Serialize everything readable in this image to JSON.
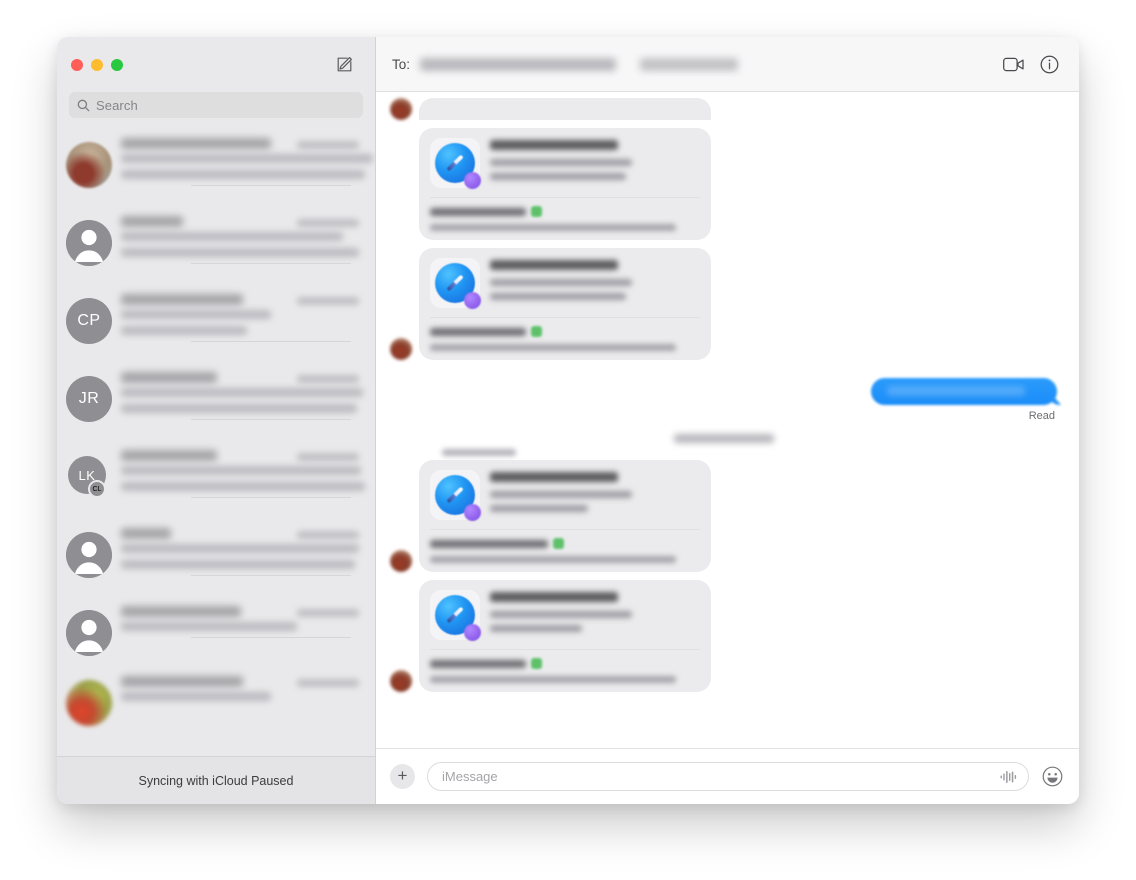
{
  "window": {
    "traffic_lights": [
      {
        "name": "close",
        "color": "#ff5f57"
      },
      {
        "name": "minimize",
        "color": "#febc2e"
      },
      {
        "name": "maximize",
        "color": "#28c840"
      }
    ]
  },
  "sidebar": {
    "compose_icon": "compose-icon",
    "search": {
      "placeholder": "Search",
      "icon": "search-icon"
    },
    "conversations": [
      {
        "avatar_type": "photo",
        "avatar_value": "",
        "unread": true,
        "name": "",
        "time": "",
        "snippet_lines": 2
      },
      {
        "avatar_type": "person",
        "avatar_value": "",
        "unread": true,
        "name": "",
        "time": "",
        "snippet_lines": 2
      },
      {
        "avatar_type": "initials",
        "avatar_value": "CP",
        "unread": true,
        "name": "",
        "time": "",
        "snippet_lines": 2
      },
      {
        "avatar_type": "initials",
        "avatar_value": "JR",
        "unread": false,
        "name": "",
        "time": "",
        "snippet_lines": 2
      },
      {
        "avatar_type": "initials-group",
        "avatar_value": "LK",
        "badge_value": "CL",
        "unread": false,
        "name": "",
        "time": "",
        "snippet_lines": 2
      },
      {
        "avatar_type": "person",
        "avatar_value": "",
        "unread": true,
        "name": "",
        "time": "",
        "snippet_lines": 2
      },
      {
        "avatar_type": "person",
        "avatar_value": "",
        "unread": true,
        "name": "",
        "time": "",
        "snippet_lines": 1
      },
      {
        "avatar_type": "photo2",
        "avatar_value": "",
        "unread": false,
        "name": "",
        "time": "",
        "snippet_lines": 1
      }
    ],
    "footer_status": "Syncing with iCloud Paused"
  },
  "thread": {
    "header": {
      "to_label": "To:",
      "recipient_primary": "",
      "recipient_secondary": "",
      "facetime_icon": "video-camera-icon",
      "info_icon": "info-circle-icon"
    },
    "messages": [
      {
        "kind": "link-card-partial",
        "side": "in"
      },
      {
        "kind": "link-card",
        "side": "in",
        "avatar": false
      },
      {
        "kind": "link-card",
        "side": "in",
        "avatar": true
      },
      {
        "kind": "blue-bubble",
        "side": "out",
        "receipt": "Read"
      },
      {
        "kind": "date-separator",
        "side": "center",
        "text": ""
      },
      {
        "kind": "sender-label",
        "side": "in",
        "text": ""
      },
      {
        "kind": "link-card",
        "side": "in",
        "avatar": true
      },
      {
        "kind": "link-card",
        "side": "in",
        "avatar": true
      }
    ]
  },
  "compose": {
    "plus_label": "+",
    "plus_icon": "plus-icon",
    "placeholder": "iMessage",
    "value": "",
    "audio_icon": "audio-waveform-icon",
    "emoji_icon": "smiley-face-icon"
  },
  "colors": {
    "accent_blue": "#0a7cff",
    "bubble_blue": "#1a8cf8",
    "sidebar_bg": "#e9e9eb",
    "card_bg": "#ebebed",
    "traffic_red": "#ff5f57",
    "traffic_yellow": "#febc2e",
    "traffic_green": "#28c840"
  }
}
